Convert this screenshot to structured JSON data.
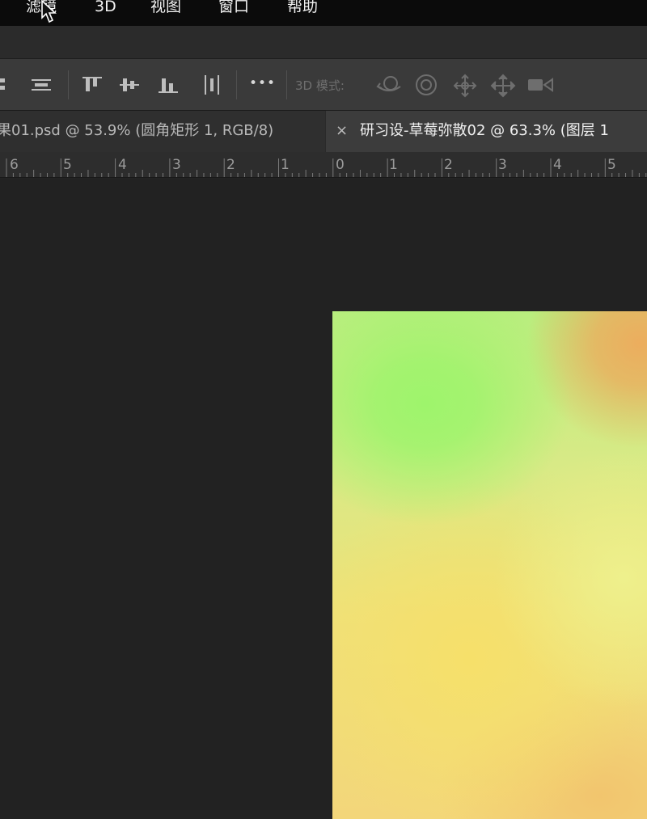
{
  "menubar": {
    "items": [
      {
        "label": "滤镜",
        "name": "menu-filter"
      },
      {
        "label": "3D",
        "name": "menu-3d"
      },
      {
        "label": "视图",
        "name": "menu-view"
      },
      {
        "label": "窗口",
        "name": "menu-window"
      },
      {
        "label": "帮助",
        "name": "menu-help"
      }
    ]
  },
  "options_bar": {
    "more_label": "•••",
    "mode_3d_label": "3D 模式:",
    "mode_icons": [
      "orbit-3d-icon",
      "roll-3d-icon",
      "pan-3d-icon",
      "slide-3d-icon",
      "scale-3d-video-icon"
    ],
    "align_icons": [
      "distribute-icon",
      "align-center-icon",
      "align-top-icon",
      "align-vcenter-icon",
      "align-bottom-icon",
      "distribute-hcenter-icon"
    ]
  },
  "tabs": [
    {
      "label": "果01.psd @ 53.9% (圆角矩形 1, RGB/8)",
      "active": false
    },
    {
      "label": "研习设-草莓弥散02 @ 63.3% (图层 1",
      "active": true,
      "close_label": "×"
    }
  ],
  "ruler": {
    "labels": [
      "6",
      "5",
      "4",
      "3",
      "2",
      "1",
      "0",
      "1",
      "2",
      "3",
      "4",
      "5"
    ]
  },
  "colors": {
    "menubar_bg": "#0b0b0b",
    "workspace_bg": "#222222",
    "canvas_green": "#9ef46c",
    "canvas_yellow": "#f6e06a",
    "canvas_orange": "#ecad5e"
  }
}
